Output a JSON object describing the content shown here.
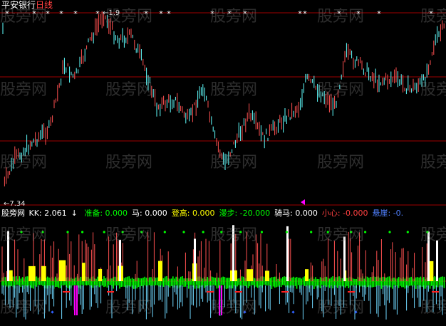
{
  "header": {
    "stock_name": "平安银行",
    "period": "日线",
    "price_high_label": "←1.9",
    "price_low_label": "←7.34"
  },
  "indicator": {
    "name": "股旁网",
    "items": [
      {
        "label": "KK:",
        "value": "2.061",
        "color": "#ffffff"
      },
      {
        "label": "↓",
        "value": "",
        "color": "#ffffff"
      },
      {
        "label": "准备:",
        "value": "0.000",
        "color": "#00ff00"
      },
      {
        "label": "马:",
        "value": "0.000",
        "color": "#ffffff"
      },
      {
        "label": "登高:",
        "value": "0.000",
        "color": "#ffff00"
      },
      {
        "label": "漫步:",
        "value": "-20.000",
        "color": "#00ff00"
      },
      {
        "label": "骑马:",
        "value": "0.000",
        "color": "#ffffff"
      },
      {
        "label": "小心:",
        "value": "-0.000",
        "color": "#ff4040"
      },
      {
        "label": "悬崖:",
        "value": "-0.",
        "color": "#5080ff"
      }
    ]
  },
  "watermark": "股旁网",
  "colors": {
    "up": "#ff5050",
    "down": "#60ffff",
    "grid": "#a00000",
    "signal_white": "#ffffff",
    "signal_yellow": "#ffff00",
    "signal_green": "#00ff00",
    "signal_cyan": "#70d8ff",
    "signal_magenta": "#ff00ff",
    "signal_blue": "#3060ff"
  }
}
